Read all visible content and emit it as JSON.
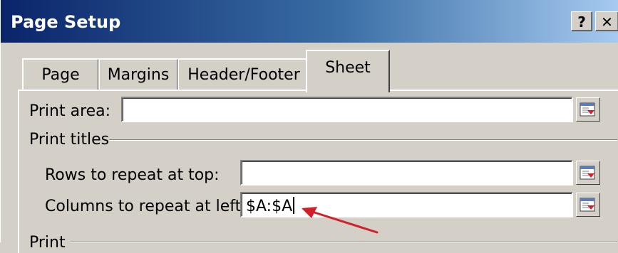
{
  "window": {
    "title": "Page Setup",
    "help_label": "?",
    "close_label": "✕"
  },
  "tabs": [
    {
      "label": "Page"
    },
    {
      "label": "Margins"
    },
    {
      "label": "Header/Footer"
    },
    {
      "label": "Sheet",
      "selected": true
    }
  ],
  "print_area": {
    "label": "Print area:",
    "value": ""
  },
  "print_titles": {
    "group_label": "Print titles",
    "rows_label": "Rows to repeat at top:",
    "rows_value": "",
    "columns_label": "Columns to repeat at left:",
    "columns_value": "$A:$A"
  },
  "print_group": {
    "label": "Print"
  },
  "icons": {
    "collapse_dialog": "collapse-dialog-icon",
    "annotation": "red-arrow-annotation"
  },
  "colors": {
    "titlebar_start": "#0a246a",
    "titlebar_end": "#a6caf0",
    "dialog_bg": "#d4d0c8",
    "arrow": "#d0202a"
  }
}
